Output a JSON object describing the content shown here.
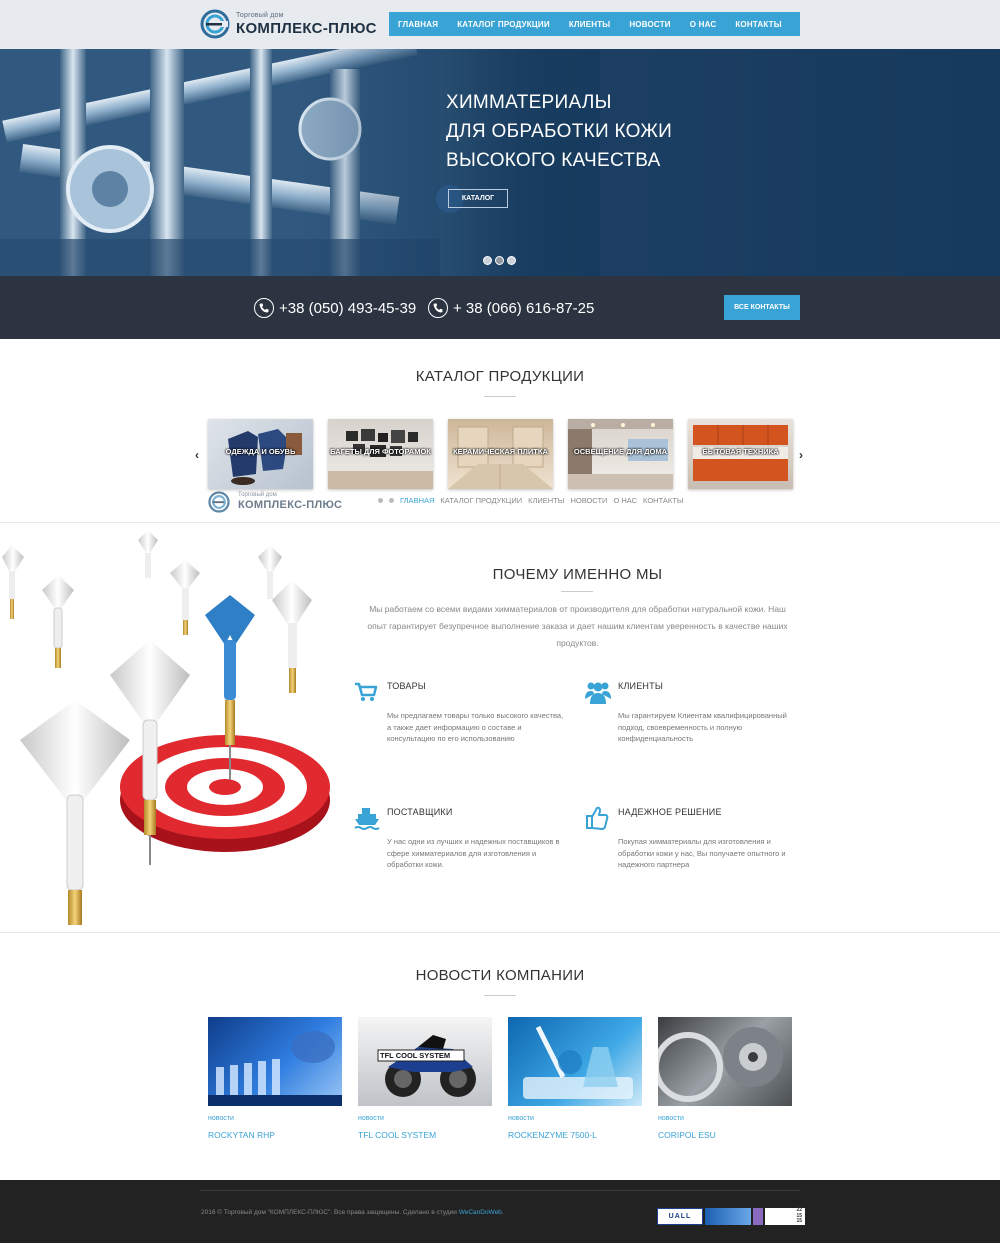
{
  "header": {
    "logo_small": "Торговый дом",
    "logo_big": "КОМПЛЕКС-ПЛЮС",
    "nav": [
      "ГЛАВНАЯ",
      "КАТАЛОГ ПРОДУКЦИИ",
      "КЛИЕНТЫ",
      "НОВОСТИ",
      "О НАС",
      "КОНТАКТЫ"
    ]
  },
  "hero": {
    "title_lines": [
      "ХИММАТЕРИАЛЫ",
      "ДЛЯ ОБРАБОТКИ КОЖИ",
      "ВЫСОКОГО КАЧЕСТВА"
    ],
    "button": "КАТАЛОГ",
    "slides": 3,
    "active_slide": 2
  },
  "contacts": {
    "phone1": "+38 (050) 493-45-39",
    "phone2": "+ 38 (066) 616-87-25",
    "button": "ВСЕ КОНТАКТЫ"
  },
  "catalog": {
    "title": "КАТАЛОГ ПРОДУКЦИИ",
    "prev": "‹",
    "next": "›",
    "items": [
      "ОДЕЖДА И ОБУВЬ",
      "БАГЕТЫ ДЛЯ ФОТОРАМОК",
      "КЕРАМИЧЕСКАЯ ПЛИТКА",
      "ОСВЕЩЕНИЕ ДЛЯ ДОМА",
      "БЫТОВАЯ ТЕХНИКА"
    ],
    "ghost_logo_small": "Торговый дом",
    "ghost_logo_big": "КОМПЛЕКС-ПЛЮС",
    "ghost_nav": [
      "ГЛАВНАЯ",
      "КАТАЛОГ ПРОДУКЦИИ",
      "КЛИЕНТЫ",
      "НОВОСТИ",
      "О НАС",
      "КОНТАКТЫ"
    ]
  },
  "why": {
    "title": "ПОЧЕМУ ИМЕННО МЫ",
    "text": "Мы работаем со всеми видами химматериалов от производителя для обработки натуральной кожи. Наш опыт гарантирует безупречное выполнение заказа и дает нашим клиентам уверенность в качестве наших продуктов.",
    "features": [
      {
        "icon": "cart-icon",
        "title": "ТОВАРЫ",
        "text": "Мы предлагаем товары только высокого качества, а также дает информацию о составе и консультацию по его использованию"
      },
      {
        "icon": "users-icon",
        "title": "КЛИЕНТЫ",
        "text": "Мы гарантируем Клиентам квалифицированный подход, своевременность и полную конфиденциальность"
      },
      {
        "icon": "ship-icon",
        "title": "ПОСТАВЩИКИ",
        "text": "У нас одни из лучших и надежных поставщиков в сфере химматериалов для изготовления и обработки кожи."
      },
      {
        "icon": "thumbs-up-icon",
        "title": "НАДЕЖНОЕ РЕШЕНИЕ",
        "text": "Покупая химматериалы для изготовления и обработки кожи у нас, Вы получаете опытного и надежного партнера"
      }
    ]
  },
  "news": {
    "title": "НОВОСТИ КОМПАНИИ",
    "items": [
      {
        "category": "новости",
        "title": "ROCKYTAN RHP"
      },
      {
        "category": "новости",
        "title": "TFL COOL SYSTEM",
        "image_text": "TFL COOL SYSTEM"
      },
      {
        "category": "новости",
        "title": "ROCKENZYME 7500-L"
      },
      {
        "category": "новости",
        "title": "CORIPOL ESU"
      }
    ]
  },
  "footer": {
    "copyright": "2016 © Торговый дом \"КОМПЛЕКС-ПЛЮС\". Все права защищены. Сделано в студии ",
    "studio": "WeCanDoWeb",
    "badge1": "UALL",
    "counter": [
      "22",
      "15",
      "15"
    ]
  },
  "colors": {
    "accent": "#3aa3d6",
    "dark_strip": "#2b3440",
    "footer": "#222222"
  }
}
